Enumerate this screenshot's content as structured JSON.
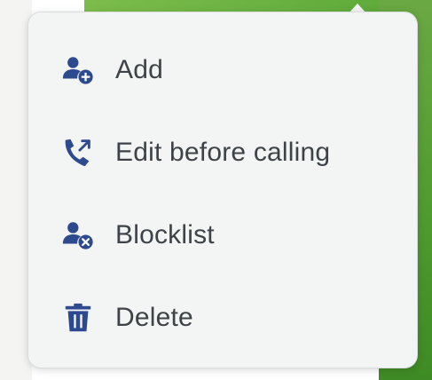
{
  "colors": {
    "icon": "#2e4a8f",
    "text": "#3d4346",
    "popup_bg": "#f3f4f4",
    "background_green": "#5aa838"
  },
  "menu": {
    "items": [
      {
        "label": "Add",
        "icon": "person-add-icon"
      },
      {
        "label": "Edit before calling",
        "icon": "phone-callback-icon"
      },
      {
        "label": "Blocklist",
        "icon": "person-block-icon"
      },
      {
        "label": "Delete",
        "icon": "trash-icon"
      }
    ]
  }
}
